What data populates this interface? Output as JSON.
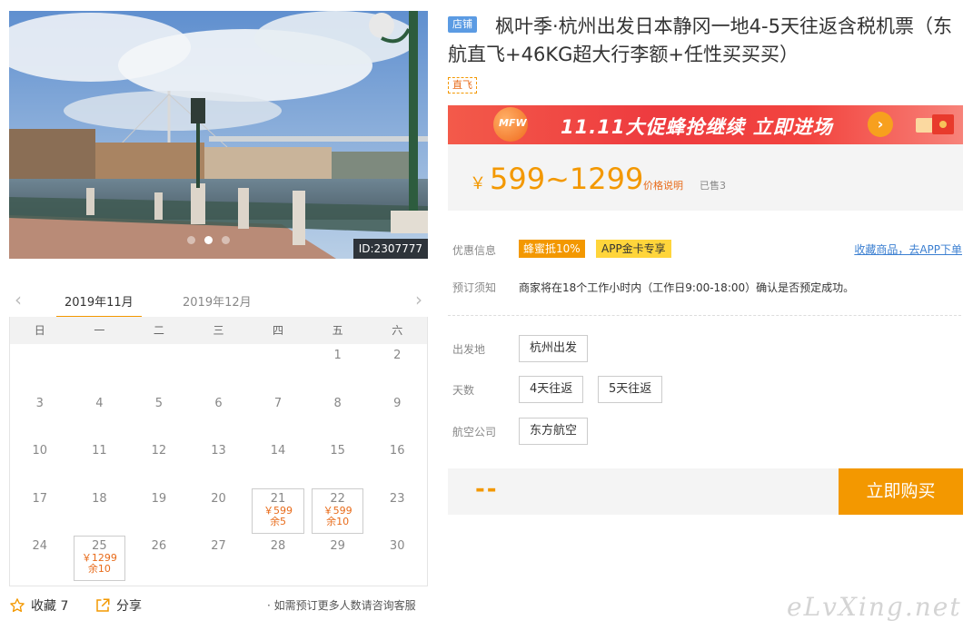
{
  "photo": {
    "id_label": "ID:2307777",
    "slide_count": 3,
    "active_slide": 1
  },
  "calendar": {
    "prev_icon": "chevron-left-icon",
    "next_icon": "chevron-right-icon",
    "months": [
      "2019年11月",
      "2019年12月"
    ],
    "active_month": 0,
    "weekdays": [
      "日",
      "一",
      "二",
      "三",
      "四",
      "五",
      "六"
    ],
    "lead_blank": 5,
    "days": [
      {
        "d": "1"
      },
      {
        "d": "2"
      },
      {
        "d": "3"
      },
      {
        "d": "4"
      },
      {
        "d": "5"
      },
      {
        "d": "6"
      },
      {
        "d": "7"
      },
      {
        "d": "8"
      },
      {
        "d": "9"
      },
      {
        "d": "10"
      },
      {
        "d": "11"
      },
      {
        "d": "12"
      },
      {
        "d": "13"
      },
      {
        "d": "14"
      },
      {
        "d": "15"
      },
      {
        "d": "16"
      },
      {
        "d": "17"
      },
      {
        "d": "18"
      },
      {
        "d": "19"
      },
      {
        "d": "20"
      },
      {
        "d": "21",
        "price": "￥599",
        "left": "余5"
      },
      {
        "d": "22",
        "price": "￥599",
        "left": "余10"
      },
      {
        "d": "23"
      },
      {
        "d": "24"
      },
      {
        "d": "25",
        "price": "￥1299",
        "left": "余10"
      },
      {
        "d": "26"
      },
      {
        "d": "27"
      },
      {
        "d": "28"
      },
      {
        "d": "29"
      },
      {
        "d": "30"
      }
    ]
  },
  "actions": {
    "favorite_label": "收藏 7",
    "favorite_icon": "star-outline-icon",
    "share_label": "分享",
    "share_icon": "share-icon",
    "consult_text": "· 如需预订更多人数请咨询客服"
  },
  "product": {
    "shop_tag": "店铺",
    "title": "枫叶季·杭州出发日本静冈一地4-5天往返含税机票（东航直飞+46KG超大行李额+任性买买买）",
    "feature_tag": "直飞"
  },
  "banner": {
    "badge": "MFW",
    "text": "11.11大促蜂抢继续  立即进场",
    "go_icon": "arrow-right-icon"
  },
  "price": {
    "currency": "￥",
    "range": "599~1299",
    "note": "价格说明",
    "sold": "已售3"
  },
  "info": {
    "discount_label": "优惠信息",
    "discount_tag": "蜂蜜抵10%",
    "app_tag": "APP金卡专享",
    "app_link": "收藏商品，去APP下单",
    "notice_label": "预订须知",
    "notice_text": "商家将在18个工作小时内（工作日9:00-18:00）确认是否预定成功。"
  },
  "options": {
    "departure_label": "出发地",
    "departure_values": [
      "杭州出发"
    ],
    "days_label": "天数",
    "days_values": [
      "4天往返",
      "5天往返"
    ],
    "airline_label": "航空公司",
    "airline_values": [
      "东方航空"
    ]
  },
  "buy": {
    "price_placeholder": "--",
    "button_label": "立即购买"
  },
  "watermark": "eLvXing.net",
  "colors": {
    "accent": "#f39800",
    "price": "#e86b1a",
    "link": "#3b7fd1",
    "shop_tag": "#5b9be3",
    "banner": "#ee3b3f"
  }
}
